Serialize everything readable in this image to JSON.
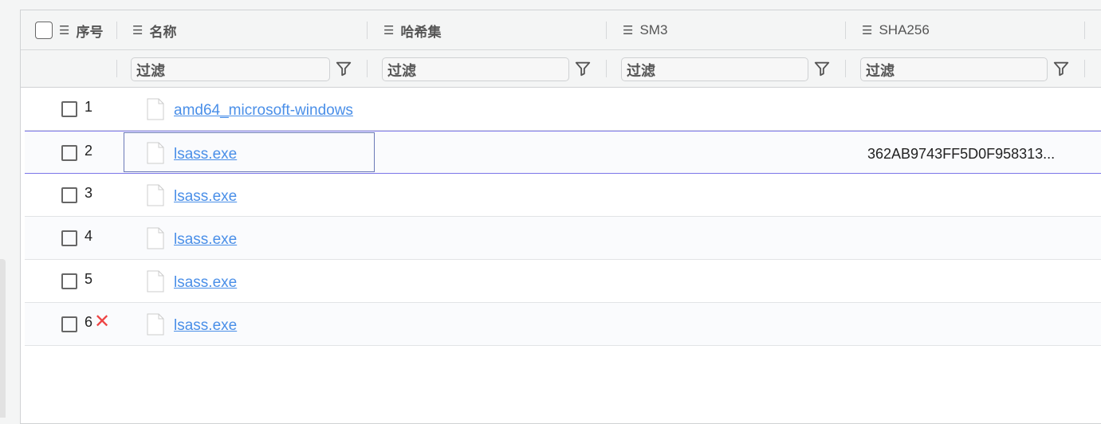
{
  "header": {
    "columns": [
      "序号",
      "名称",
      "哈希集",
      "SM3",
      "SHA256"
    ]
  },
  "filter": {
    "placeholder": "过滤"
  },
  "rows": [
    {
      "index": "1",
      "name": "amd64_microsoft-windows",
      "sha256": ""
    },
    {
      "index": "2",
      "name": "lsass.exe",
      "sha256": "362AB9743FF5D0F958313..."
    },
    {
      "index": "3",
      "name": "lsass.exe",
      "sha256": ""
    },
    {
      "index": "4",
      "name": "lsass.exe",
      "sha256": ""
    },
    {
      "index": "5",
      "name": "lsass.exe",
      "sha256": ""
    },
    {
      "index": "6",
      "name": "lsass.exe",
      "sha256": "",
      "marker": "✕"
    }
  ],
  "colors": {
    "link": "#4a8fe8",
    "selection": "#7b76e8",
    "error": "#e44444"
  }
}
